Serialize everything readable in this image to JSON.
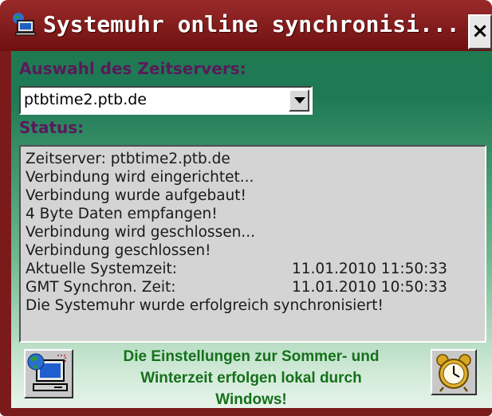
{
  "window": {
    "title": "Systemuhr online synchronisi...",
    "close_label": "×"
  },
  "server": {
    "label": "Auswahl des Zeitservers:",
    "selected": "ptbtime2.ptb.de"
  },
  "status": {
    "label": "Status:",
    "lines": [
      "Zeitserver: ptbtime2.ptb.de",
      "Verbindung wird eingerichtet...",
      "Verbindung wurde aufgebaut!",
      "4 Byte Daten empfangen!",
      "Verbindung wird geschlossen...",
      "Verbindung geschlossen!"
    ],
    "system_time_label": "Aktuelle Systemzeit:",
    "system_time_value": "11.01.2010 11:50:33",
    "gmt_time_label": "GMT Synchron. Zeit:",
    "gmt_time_value": "11.01.2010 10:50:33",
    "result": "Die Systemuhr wurde erfolgreich synchronisiert!"
  },
  "footer": {
    "line1": "Die Einstellungen zur Sommer- und",
    "line2": "Winterzeit erfolgen lokal durch",
    "line3": "Windows!",
    "left_icon": "computer-globe-icon",
    "right_icon": "alarm-clock-icon"
  },
  "colors": {
    "titlebar": "#7a1a1a",
    "panel_top": "#1f7a52",
    "label_text": "#5a1a5a",
    "footer_text": "#15701a"
  }
}
